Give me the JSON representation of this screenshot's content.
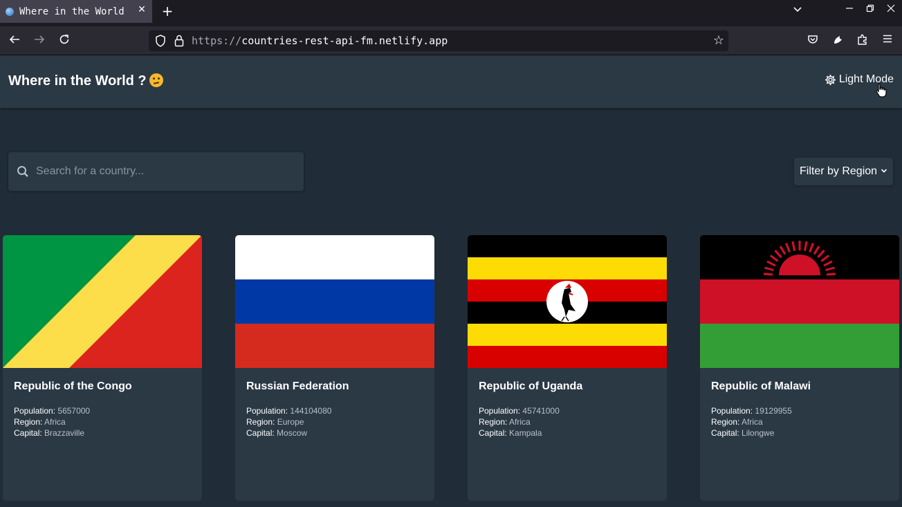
{
  "browser": {
    "tab_title": "Where in the World",
    "url_scheme": "https://",
    "url_host": "countries-rest-api-fm.netlify.app"
  },
  "header": {
    "title": "Where in the World ?",
    "mode_label": "Light Mode"
  },
  "search": {
    "placeholder": "Search for a country..."
  },
  "filter": {
    "label": "Filter by Region"
  },
  "labels": {
    "population": "Population:",
    "region": "Region:",
    "capital": "Capital:"
  },
  "countries": [
    {
      "name": "Republic of the Congo",
      "population": "5657000",
      "region": "Africa",
      "capital": "Brazzaville",
      "flag": "congo-flag"
    },
    {
      "name": "Russian Federation",
      "population": "144104080",
      "region": "Europe",
      "capital": "Moscow",
      "flag": "russia-flag"
    },
    {
      "name": "Republic of Uganda",
      "population": "45741000",
      "region": "Africa",
      "capital": "Kampala",
      "flag": "uganda-flag"
    },
    {
      "name": "Republic of Malawi",
      "population": "19129955",
      "region": "Africa",
      "capital": "Lilongwe",
      "flag": "malawi-flag"
    }
  ],
  "colors": {
    "background": "#202c37",
    "element": "#2b3945",
    "text": "#ffffff"
  }
}
